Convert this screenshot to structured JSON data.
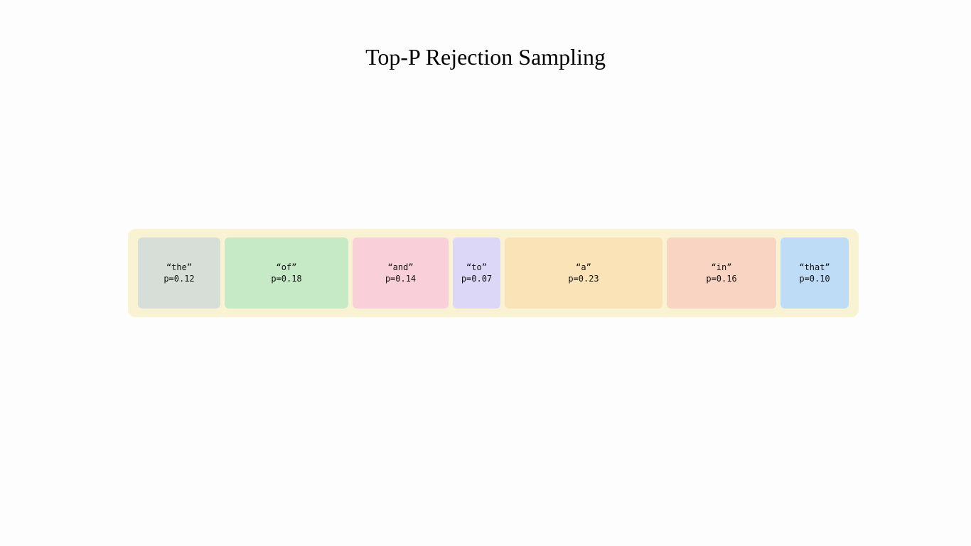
{
  "title": "Top-P Rejection Sampling",
  "band_inner_width": 1000,
  "tokens": [
    {
      "word": "the",
      "p": 0.12,
      "color": "#d6ded7"
    },
    {
      "word": "of",
      "p": 0.18,
      "color": "#c6e9c6"
    },
    {
      "word": "and",
      "p": 0.14,
      "color": "#f9cfd9"
    },
    {
      "word": "to",
      "p": 0.07,
      "color": "#dcd6f7"
    },
    {
      "word": "a",
      "p": 0.23,
      "color": "#fbe3b8"
    },
    {
      "word": "in",
      "p": 0.16,
      "color": "#f9d4c2"
    },
    {
      "word": "that",
      "p": 0.1,
      "color": "#bfdcf7"
    }
  ]
}
